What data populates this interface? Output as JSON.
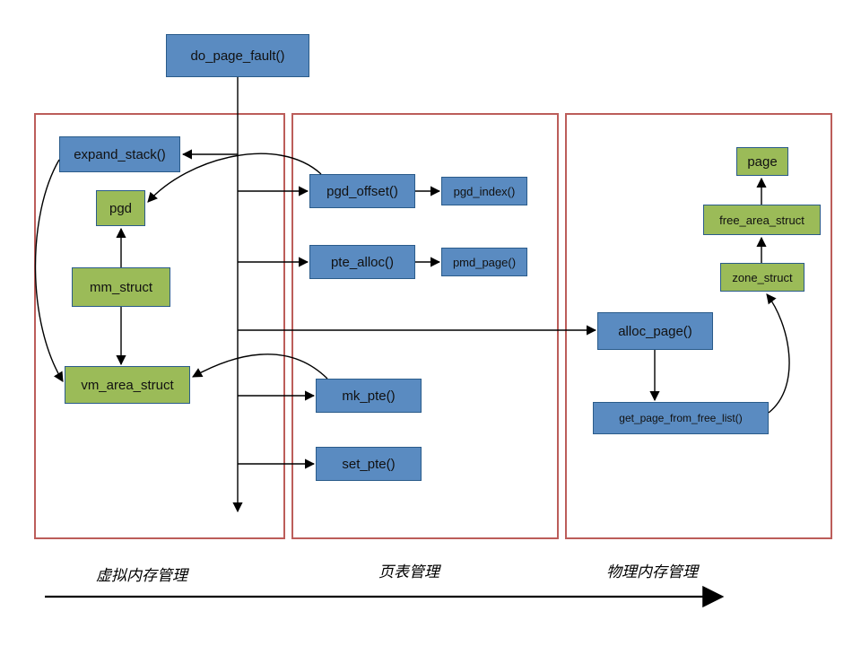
{
  "top": {
    "do_page_fault": "do_page_fault()"
  },
  "left": {
    "expand_stack": "expand_stack()",
    "pgd": "pgd",
    "mm_struct": "mm_struct",
    "vm_area_struct": "vm_area_struct"
  },
  "middle": {
    "pgd_offset": "pgd_offset()",
    "pgd_index": "pgd_index()",
    "pte_alloc": "pte_alloc()",
    "pmd_page": "pmd_page()",
    "mk_pte": "mk_pte()",
    "set_pte": "set_pte()"
  },
  "right": {
    "page": "page",
    "free_area_struct": "free_area_struct",
    "zone_struct": "zone_struct",
    "alloc_page": "alloc_page()",
    "get_page_from_free_list": "get_page_from_free_list()"
  },
  "captions": {
    "virtual": "虚拟内存管理",
    "pagetable": "页表管理",
    "physical": "物理内存管理"
  }
}
